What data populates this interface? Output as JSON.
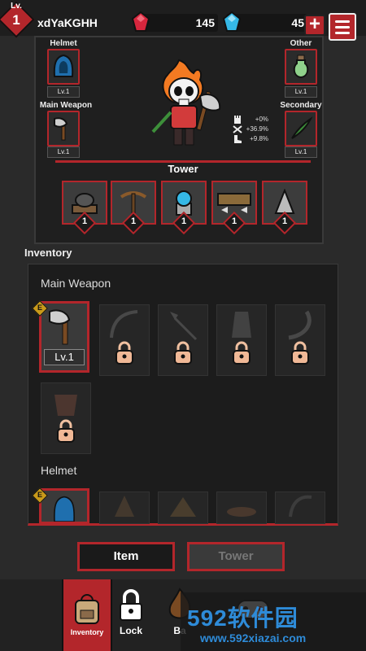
{
  "player": {
    "level_label": "Lv.",
    "level": "1",
    "name": "xdYaKGHH"
  },
  "currency": {
    "red_gems": "145",
    "blue_gems": "45",
    "red_color": "#d7263d",
    "blue_color": "#35b8e6"
  },
  "equipment": {
    "helmet": {
      "label": "Helmet",
      "level": "Lv.1",
      "icon": "hood-icon"
    },
    "main_weapon": {
      "label": "Main Weapon",
      "level": "Lv.1",
      "icon": "axe-icon"
    },
    "other": {
      "label": "Other",
      "level": "Lv.1",
      "icon": "potion-icon"
    },
    "secondary": {
      "label": "Secondary",
      "level": "Lv.1",
      "icon": "blade-icon"
    }
  },
  "stats": [
    {
      "icon": "rook-icon",
      "value": "+0%"
    },
    {
      "icon": "crossed-swords-icon",
      "value": "+36.9%"
    },
    {
      "icon": "boot-icon",
      "value": "+9.8%"
    }
  ],
  "tower": {
    "title": "Tower",
    "slots": [
      {
        "icon": "cannon-icon",
        "count": "1"
      },
      {
        "icon": "crossbow-icon",
        "count": "1"
      },
      {
        "icon": "orb-tower-icon",
        "count": "1"
      },
      {
        "icon": "barricade-icon",
        "count": "1"
      },
      {
        "icon": "spike-icon",
        "count": "1"
      }
    ]
  },
  "inventory": {
    "title": "Inventory",
    "sections": [
      {
        "title": "Main Weapon",
        "items": [
          {
            "icon": "axe-icon",
            "level": "Lv.1",
            "equipped": true,
            "badge": "E"
          },
          {
            "icon": "bow-icon",
            "locked": true
          },
          {
            "icon": "spear-icon",
            "locked": true
          },
          {
            "icon": "gauntlet-icon",
            "locked": true
          },
          {
            "icon": "horn-icon",
            "locked": true
          },
          {
            "icon": "cauldron-icon",
            "locked": true
          }
        ]
      },
      {
        "title": "Helmet",
        "items": [
          {
            "icon": "hood-icon",
            "equipped": true,
            "badge": "E"
          },
          {
            "icon": "witch-hat-icon",
            "locked": true
          },
          {
            "icon": "straw-hat-icon",
            "locked": true
          },
          {
            "icon": "wide-hat-icon",
            "locked": true
          },
          {
            "icon": "scythe-hood-icon",
            "locked": true
          }
        ]
      }
    ]
  },
  "tabs": {
    "item": "Item",
    "tower": "Tower"
  },
  "nav": [
    {
      "label": "Inventory",
      "icon": "backpack-icon",
      "selected": true
    },
    {
      "label": "Lock",
      "icon": "lock-icon"
    },
    {
      "label": "Ba",
      "icon": "fire-icon"
    },
    {
      "label": "",
      "icon": "gamepad-icon"
    }
  ],
  "watermark": {
    "text": "592软件园",
    "url": "www.592xiazai.com"
  },
  "accent": "#b3262b"
}
